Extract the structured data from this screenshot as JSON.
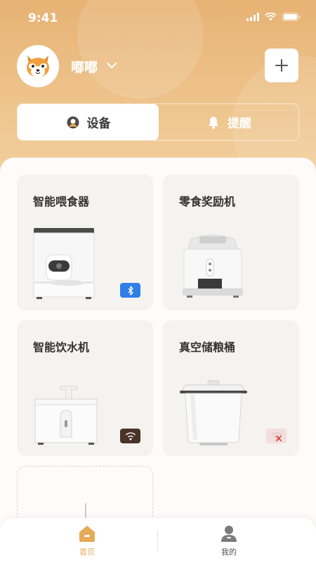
{
  "status": {
    "time": "9:41"
  },
  "header": {
    "pet_name": "嘟嘟",
    "avatar": "shiba-dog-avatar",
    "add_icon": "plus-icon"
  },
  "tabs_top": [
    {
      "label": "设备",
      "icon": "location-pin-icon",
      "active": true
    },
    {
      "label": "提醒",
      "icon": "bell-icon",
      "active": false
    }
  ],
  "devices": [
    {
      "name": "智能喂食器",
      "connection": "bluetooth"
    },
    {
      "name": "零食奖励机",
      "connection": "none"
    },
    {
      "name": "智能饮水机",
      "connection": "wifi"
    },
    {
      "name": "真空储粮桶",
      "connection": "wifi-off"
    }
  ],
  "bottom_nav": [
    {
      "label": "首页",
      "icon": "home-icon",
      "active": true
    },
    {
      "label": "我的",
      "icon": "profile-icon",
      "active": false
    }
  ],
  "colors": {
    "accent": "#e6a955",
    "bluetooth": "#2f7fe8",
    "wifi": "#4a3328",
    "wifi_off": "#f2dede"
  }
}
